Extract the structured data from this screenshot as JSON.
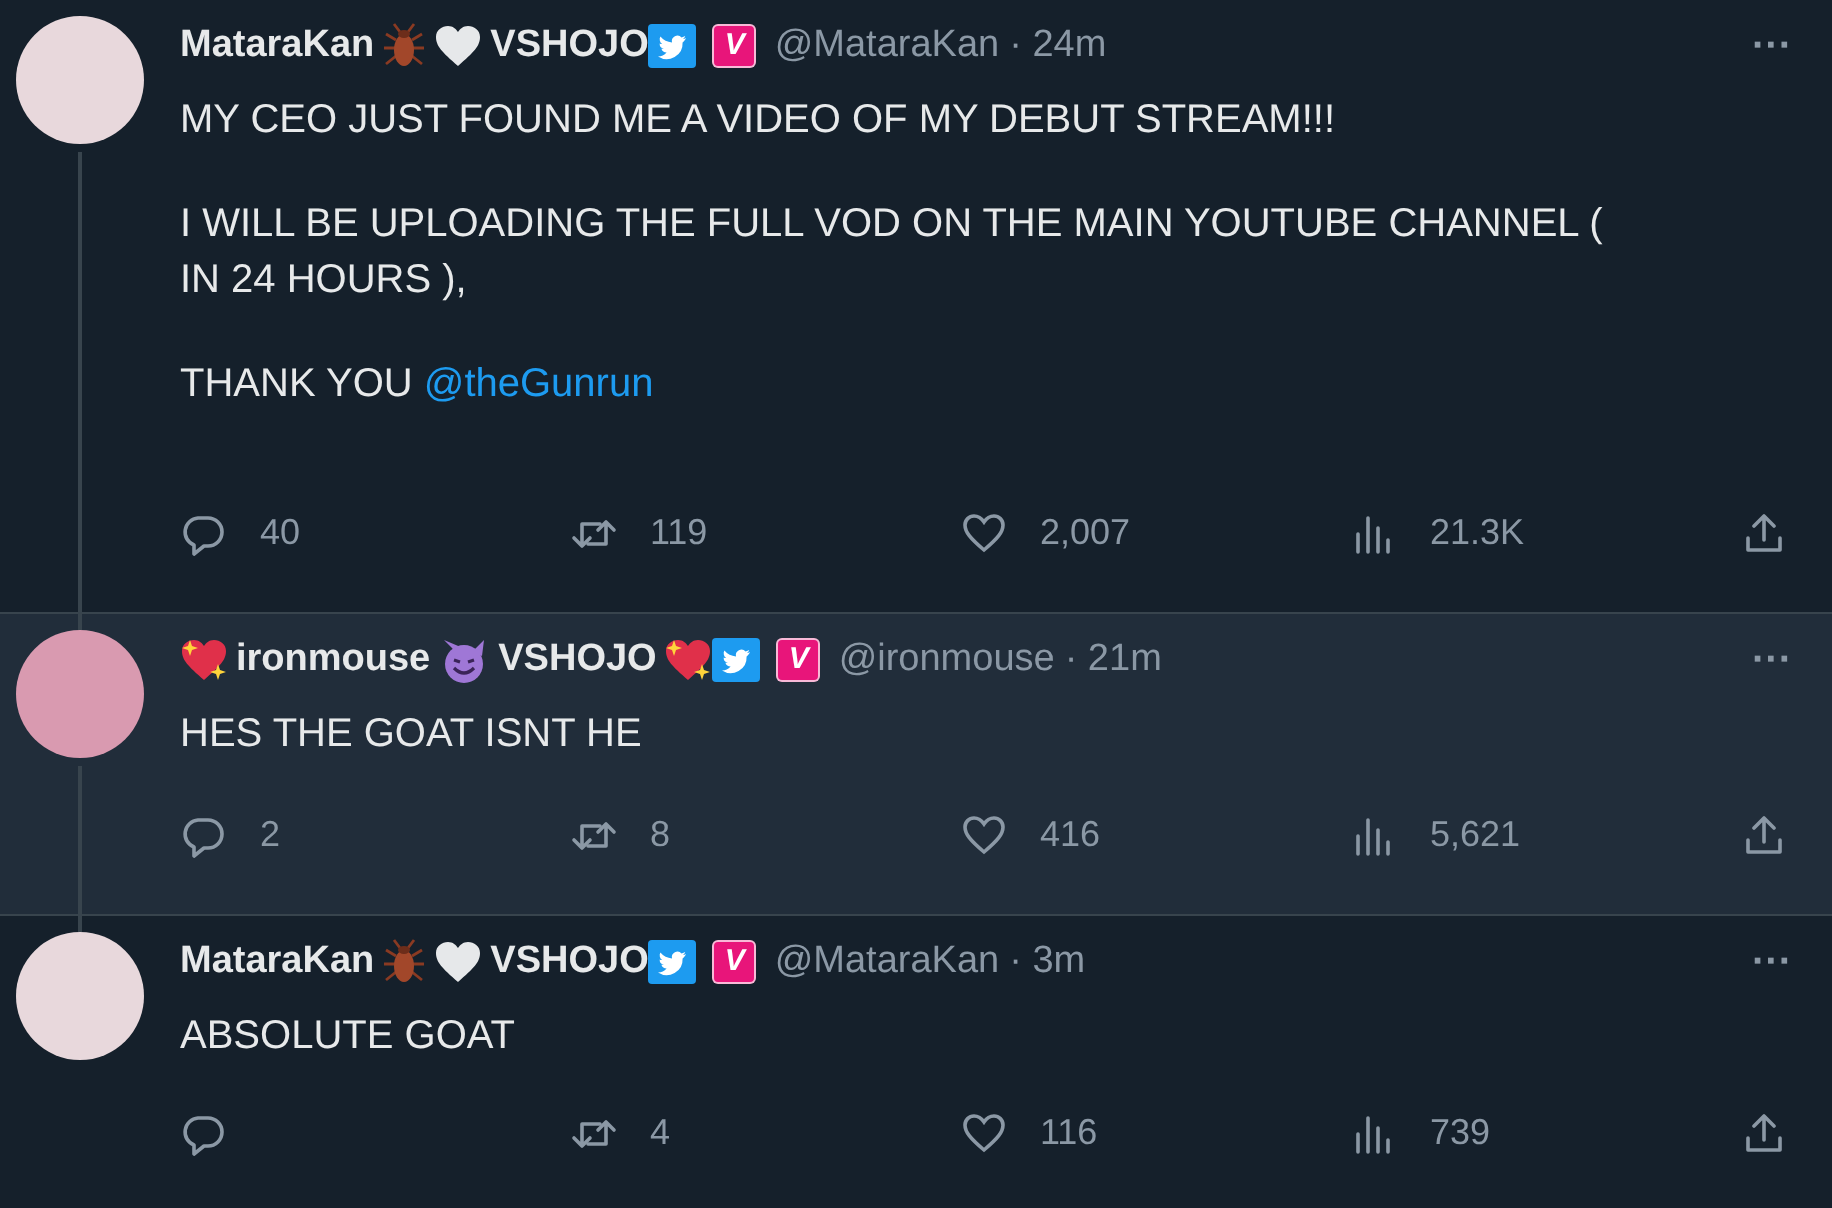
{
  "tweets": [
    {
      "highlighted": false,
      "name_parts": [
        {
          "kind": "text",
          "text": "MataraKan"
        },
        {
          "kind": "cockroach"
        },
        {
          "kind": "heart"
        },
        {
          "kind": "text",
          "text": "VSHOJO"
        }
      ],
      "badge_v": "V",
      "handle": "@MataraKan",
      "time": "· 24m",
      "body": [
        {
          "text": "MY CEO JUST FOUND ME A VIDEO OF MY DEBUT STREAM!!!"
        },
        {
          "text": "I WILL BE UPLOADING THE FULL VOD ON THE MAIN YOUTUBE CHANNEL ( IN 24 HOURS ),"
        },
        {
          "text": "THANK YOU",
          "mention": "@theGunrun"
        }
      ],
      "more": "···",
      "replies": "40",
      "retweets": "119",
      "likes": "2,007",
      "views": "21.3K"
    },
    {
      "highlighted": true,
      "name_parts": [
        {
          "kind": "sparkle-heart"
        },
        {
          "kind": "text",
          "text": "ironmouse"
        },
        {
          "kind": "devil"
        },
        {
          "kind": "text",
          "text": "VSHOJO"
        },
        {
          "kind": "sparkle-heart"
        }
      ],
      "badge_v": "V",
      "handle": "@ironmouse",
      "time": "· 21m",
      "body": [
        {
          "text": "HES THE GOAT ISNT HE"
        }
      ],
      "more": "···",
      "replies": "2",
      "retweets": "8",
      "likes": "416",
      "views": "5,621"
    },
    {
      "highlighted": false,
      "name_parts": [
        {
          "kind": "text",
          "text": "MataraKan"
        },
        {
          "kind": "cockroach"
        },
        {
          "kind": "heart"
        },
        {
          "kind": "text",
          "text": "VSHOJO"
        }
      ],
      "badge_v": "V",
      "handle": "@MataraKan",
      "time": "· 3m",
      "body": [
        {
          "text": "ABSOLUTE GOAT"
        }
      ],
      "more": "···",
      "retweets": "4",
      "likes": "116",
      "views": "739"
    }
  ]
}
